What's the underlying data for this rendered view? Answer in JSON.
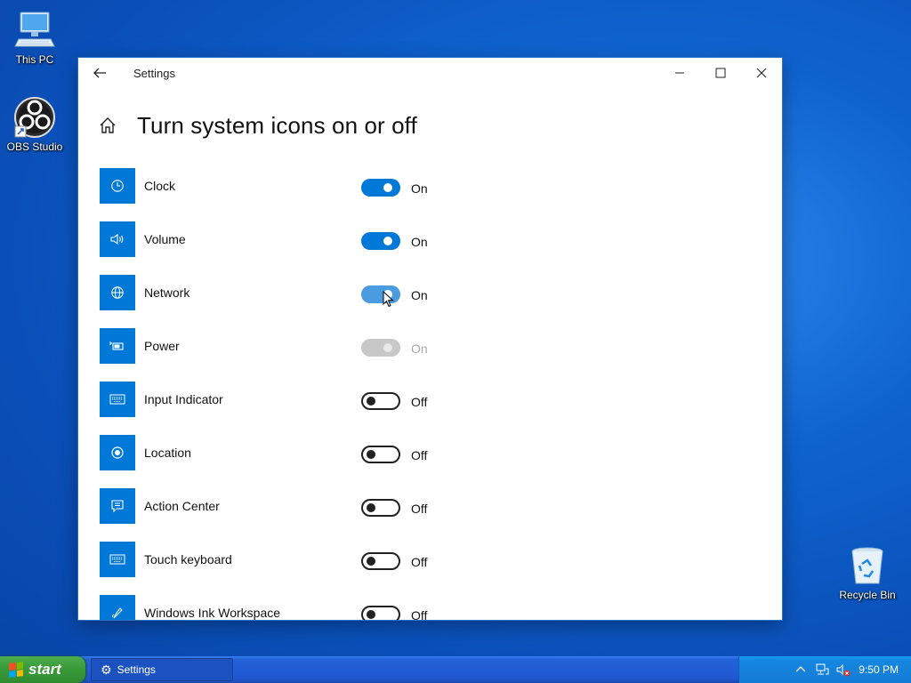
{
  "desktop": {
    "icons": [
      {
        "label": "This PC"
      },
      {
        "label": "OBS Studio"
      },
      {
        "label": "Recycle Bin"
      }
    ]
  },
  "window": {
    "title": "Settings",
    "page_title": "Turn system icons on or off",
    "rows": [
      {
        "label": "Clock",
        "state": "On",
        "on": true,
        "icon": "clock-icon"
      },
      {
        "label": "Volume",
        "state": "On",
        "on": true,
        "icon": "volume-icon"
      },
      {
        "label": "Network",
        "state": "On",
        "on": true,
        "icon": "network-globe-icon"
      },
      {
        "label": "Power",
        "state": "On",
        "on": true,
        "disabled": true,
        "icon": "battery-icon"
      },
      {
        "label": "Input Indicator",
        "state": "Off",
        "on": false,
        "icon": "keyboard-icon"
      },
      {
        "label": "Location",
        "state": "Off",
        "on": false,
        "icon": "location-icon"
      },
      {
        "label": "Action Center",
        "state": "Off",
        "on": false,
        "icon": "action-center-icon"
      },
      {
        "label": "Touch keyboard",
        "state": "Off",
        "on": false,
        "icon": "keyboard-icon"
      },
      {
        "label": "Windows Ink Workspace",
        "state": "Off",
        "on": false,
        "icon": "pen-icon"
      }
    ]
  },
  "taskbar": {
    "start_label": "start",
    "task_label": "Settings",
    "clock": "9:50 PM"
  },
  "colors": {
    "accent": "#0078d7",
    "start_green": "#399c3a",
    "taskbar_blue": "#2158d1"
  }
}
